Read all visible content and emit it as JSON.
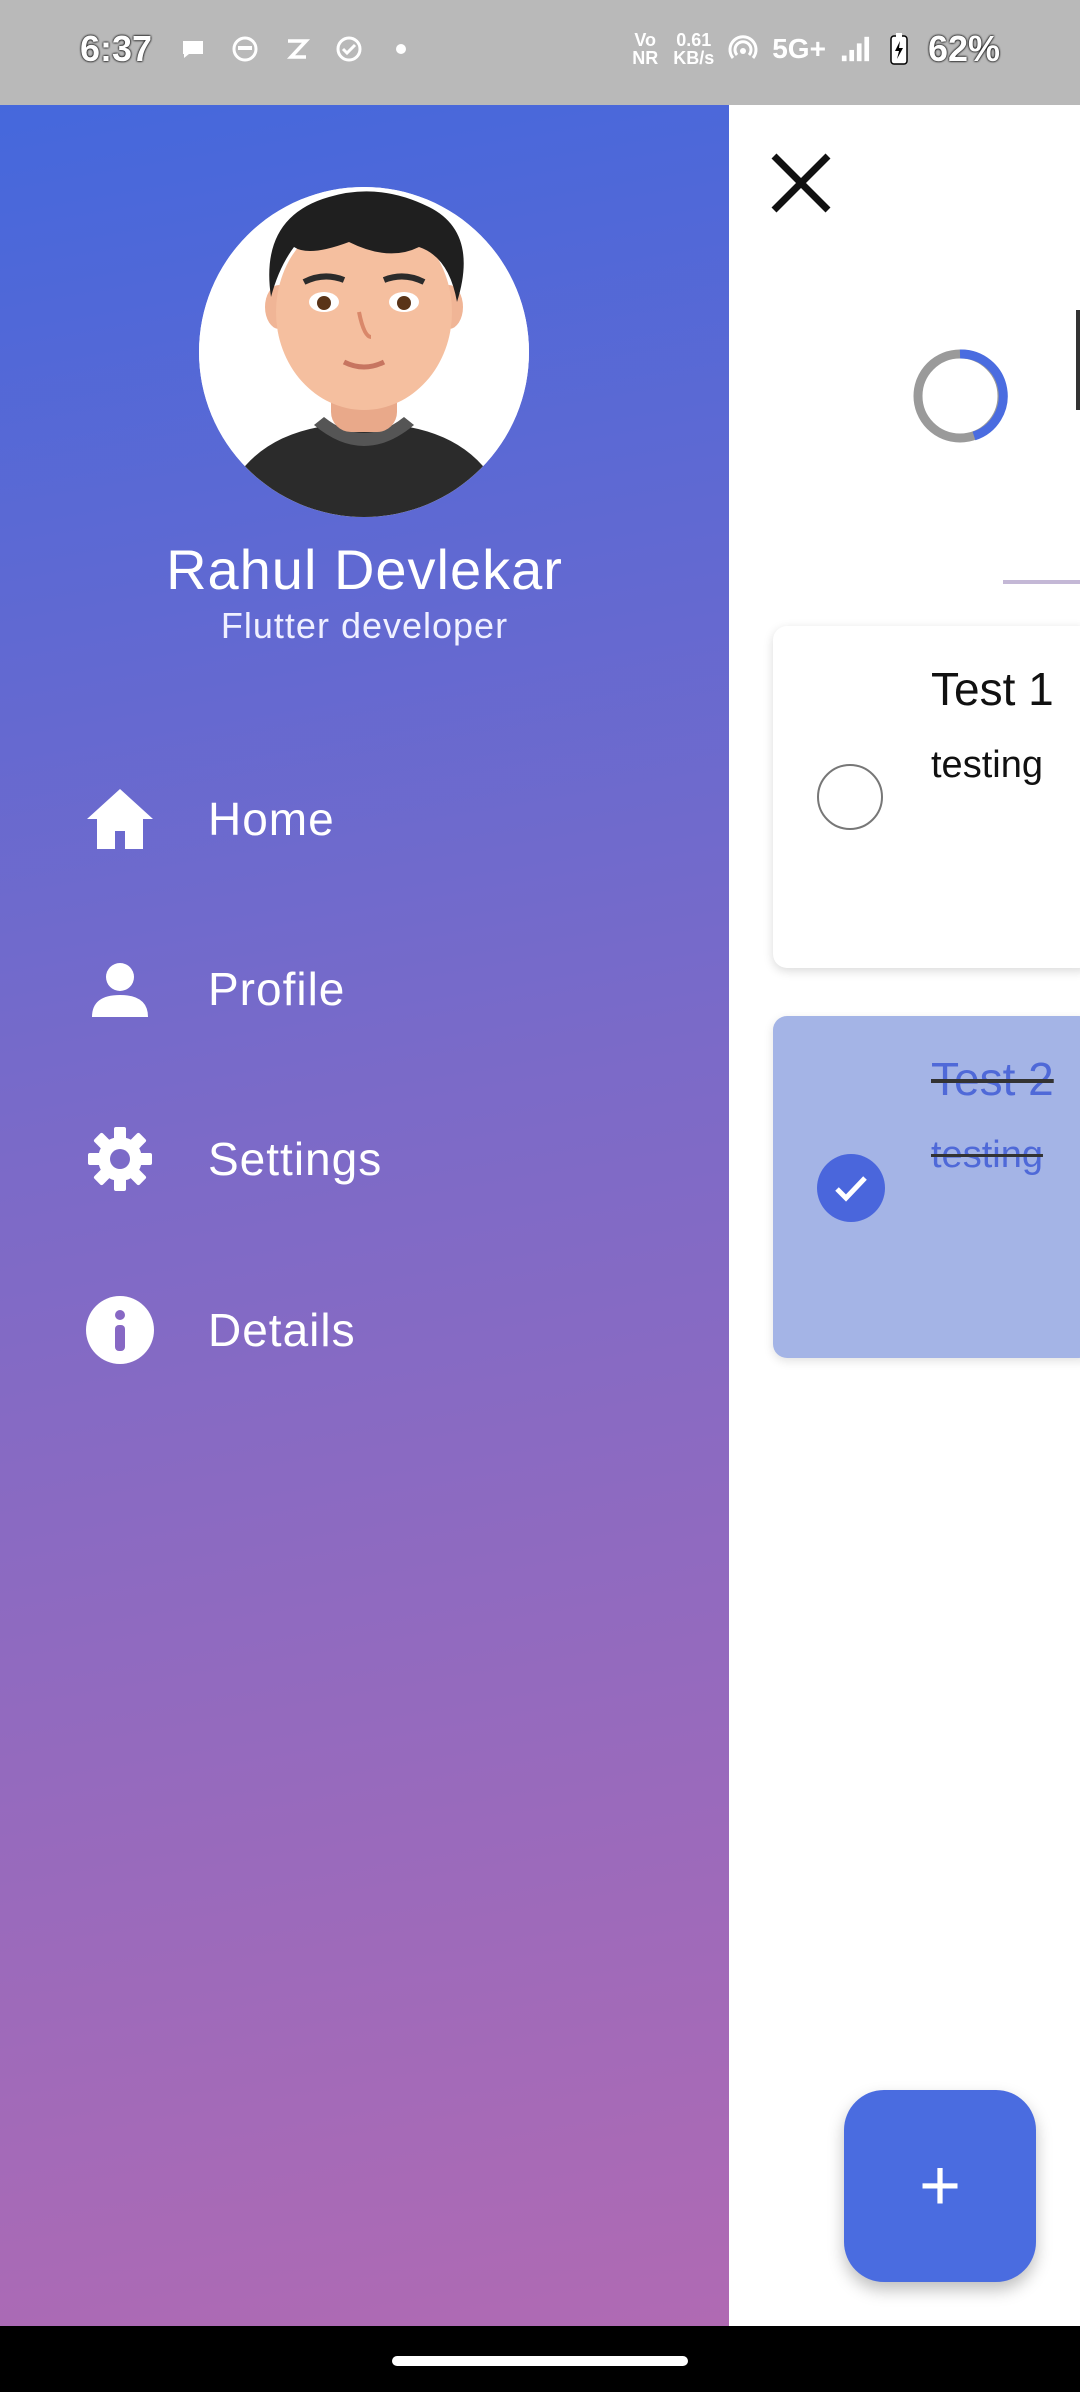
{
  "status_bar": {
    "time": "6:37",
    "volte": "Vo NR",
    "net_speed_top": "0.61",
    "net_speed_bottom": "KB/s",
    "network": "5G+",
    "battery": "62%"
  },
  "drawer": {
    "user_name": "Rahul Devlekar",
    "user_role": "Flutter developer",
    "menu": [
      {
        "label": "Home",
        "icon": "home-icon"
      },
      {
        "label": "Profile",
        "icon": "person-icon"
      },
      {
        "label": "Settings",
        "icon": "gear-icon"
      },
      {
        "label": "Details",
        "icon": "info-icon"
      }
    ]
  },
  "tasks": [
    {
      "title": "Test 1",
      "description": "testing",
      "done": false
    },
    {
      "title": "Test 2",
      "description": "testing",
      "done": true
    }
  ],
  "fab": {
    "label": "+"
  },
  "colors": {
    "gradient_start": "#4568dc",
    "gradient_end": "#b06ab3",
    "accent": "#4a6ce0",
    "done_card": "#a4b4e6"
  }
}
